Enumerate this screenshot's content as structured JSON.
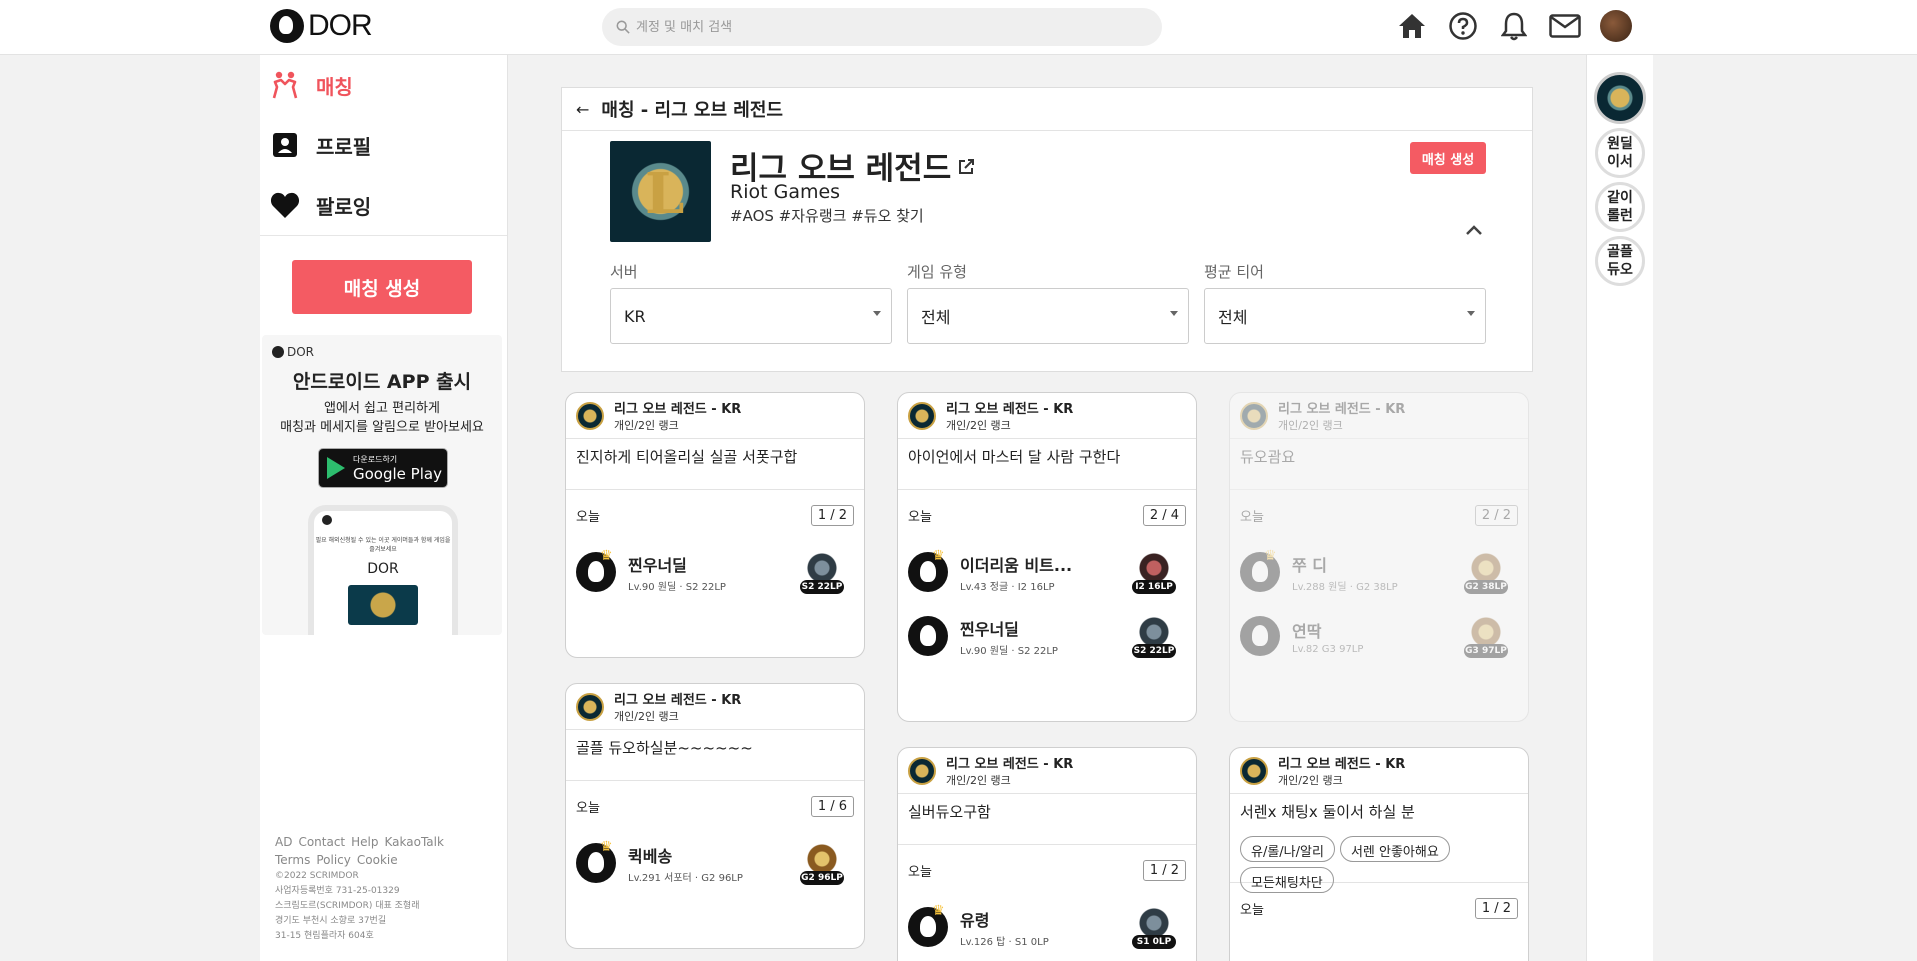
{
  "brand": {
    "name": "DOR"
  },
  "search": {
    "placeholder": "계정 및 매치 검색"
  },
  "sidebar": {
    "items": [
      {
        "label": "매칭"
      },
      {
        "label": "프로필"
      },
      {
        "label": "팔로잉"
      }
    ],
    "create_label": "매칭 생성"
  },
  "ad": {
    "logo": "DOR",
    "title": "안드로이드 APP 출시",
    "line1": "앱에서 쉽고 편리하게",
    "line2": "매칭과 메세지를 알림으로 받아보세요",
    "store_small": "다운로드하기",
    "store_big": "Google Play",
    "phone_text": "필요 해외신청될 수 있는 이곳 게이머들과 함께 게임을 즐겨보세요",
    "phone_logo": "DOR"
  },
  "footer": {
    "links": [
      "AD",
      "Contact",
      "Help",
      "KakaoTalk",
      "Terms",
      "Policy",
      "Cookie"
    ],
    "copyright": "©2022 SCRIMDOR",
    "lines": [
      "사업자등록번호 731-25-01329",
      "스크림도르(SCRIMDOR) 대표 조형래",
      "경기도 부천시 소향로 37번길",
      "31-15 현림플라자 604호"
    ]
  },
  "panel": {
    "header": "매칭 - 리그 오브 레전드",
    "game_name": "리그 오브 레전드",
    "developer": "Riot Games",
    "tags": "#AOS #자유랭크 #듀오 찾기",
    "create_label": "매칭 생성",
    "filters": [
      {
        "label": "서버",
        "value": "KR"
      },
      {
        "label": "게임 유형",
        "value": "전체"
      },
      {
        "label": "평균 티어",
        "value": "전체"
      }
    ]
  },
  "cards": [
    {
      "game": "리그 오브 레전드 - KR",
      "mode": "개인/2인 랭크",
      "title": "진지하게 티어올리실 실골 서폿구합",
      "when": "오늘",
      "count": "1 / 2",
      "players": [
        {
          "name": "찐우너딜",
          "sub": "Lv.90  원딜 · S2 22LP",
          "rank": "S2 22LP"
        }
      ]
    },
    {
      "game": "리그 오브 레전드 - KR",
      "mode": "개인/2인 랭크",
      "title": "아이언에서 마스터 달 사람 구한다",
      "when": "오늘",
      "count": "2 / 4",
      "players": [
        {
          "name": "이더리움 비트...",
          "sub": "Lv.43  정글 · I2 16LP",
          "rank": "I2 16LP"
        },
        {
          "name": "찐우너딜",
          "sub": "Lv.90  원딜 · S2 22LP",
          "rank": "S2 22LP"
        }
      ]
    },
    {
      "game": "리그 오브 레전드 - KR",
      "mode": "개인/2인 랭크",
      "title": "듀오괌요",
      "when": "오늘",
      "count": "2 / 2",
      "players": [
        {
          "name": "쭈 디",
          "sub": "Lv.288  원딜 · G2 38LP",
          "rank": "G2 38LP"
        },
        {
          "name": "연딱",
          "sub": "Lv.82  G3 97LP",
          "rank": "G3 97LP"
        }
      ]
    },
    {
      "game": "리그 오브 레전드 - KR",
      "mode": "개인/2인 랭크",
      "title": "골플 듀오하실분~~~~~~",
      "when": "오늘",
      "count": "1 / 6",
      "players": [
        {
          "name": "퀵베송",
          "sub": "Lv.291  서포터 · G2 96LP",
          "rank": "G2 96LP"
        }
      ]
    },
    {
      "game": "리그 오브 레전드 - KR",
      "mode": "개인/2인 랭크",
      "title": "실버듀오구함",
      "when": "오늘",
      "count": "1 / 2",
      "players": [
        {
          "name": "유령",
          "sub": "Lv.126  탑 · S1 0LP",
          "rank": "S1 0LP"
        }
      ]
    },
    {
      "game": "리그 오브 레전드 - KR",
      "mode": "개인/2인 랭크",
      "title": "서렌x 채팅x 둘이서 하실 분",
      "chips": [
        "유/롤/나/알리",
        "서렌 안좋아해요",
        "모든채팅차단"
      ],
      "when": "오늘",
      "count": "1 / 2"
    }
  ],
  "rightbar": {
    "items": [
      {
        "line1": "원딜",
        "line2": "이서"
      },
      {
        "line1": "같이",
        "line2": "롤런"
      },
      {
        "line1": "골플",
        "line2": "듀오"
      }
    ]
  },
  "colors": {
    "accent": "#f45b63",
    "active_nav": "#f0545c"
  }
}
